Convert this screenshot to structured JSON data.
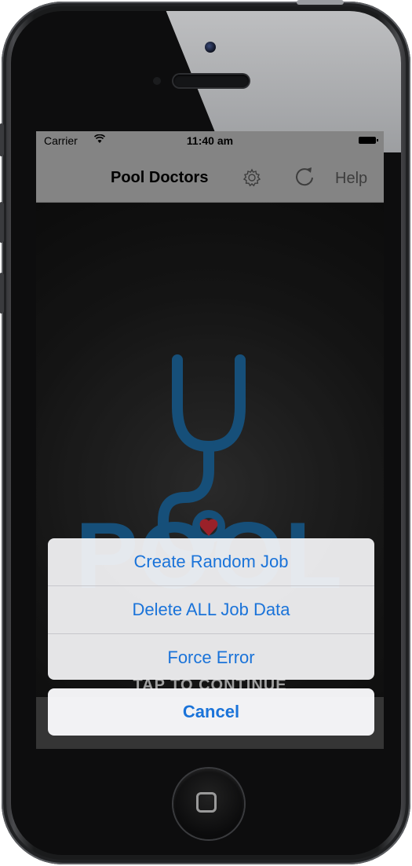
{
  "status_bar": {
    "carrier": "Carrier",
    "time": "11:40 am",
    "wifi_icon": "wifi-icon",
    "battery_icon": "battery-icon"
  },
  "nav_bar": {
    "title": "Pool Doctors",
    "settings_icon": "gear-icon",
    "refresh_icon": "refresh-icon",
    "help_label": "Help",
    "background_color": "#b8b8b8"
  },
  "main": {
    "logo_icon": "stethoscope-pool-logo",
    "logo_text": "POOL",
    "tap_prompt": "TAP TO CONTINUE"
  },
  "action_sheet": {
    "options": [
      {
        "label": "Create Random Job"
      },
      {
        "label": "Delete ALL Job Data"
      },
      {
        "label": "Force Error"
      }
    ],
    "cancel_label": "Cancel",
    "accent_color": "#1a73d9"
  },
  "device": {
    "home_button_icon": "home-square-icon"
  }
}
